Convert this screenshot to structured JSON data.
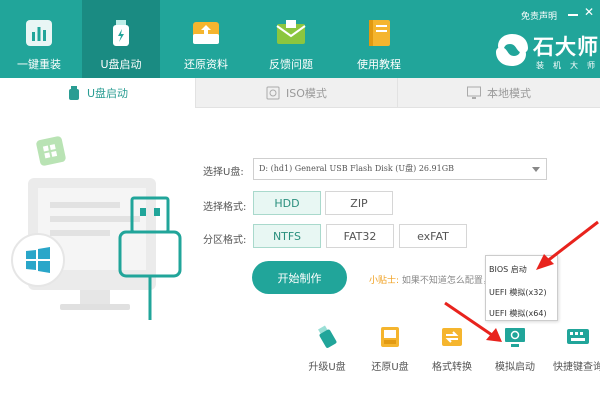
{
  "top_nav": {
    "items": [
      {
        "label": "一键重装",
        "icon": "bar-chart-icon"
      },
      {
        "label": "U盘启动",
        "icon": "usb-icon"
      },
      {
        "label": "还原资料",
        "icon": "restore-icon"
      },
      {
        "label": "反馈问题",
        "icon": "envelope-icon"
      },
      {
        "label": "使用教程",
        "icon": "book-icon"
      }
    ],
    "active_index": 1
  },
  "header": {
    "disclaimer": "免责声明",
    "minimize_glyph": "—",
    "close_glyph": "✕",
    "brand_name": "石大师",
    "brand_sub": "装机大师"
  },
  "mode_tabs": [
    {
      "label": "U盘启动",
      "icon": "usb-icon",
      "active": true
    },
    {
      "label": "ISO模式",
      "icon": "disc-icon",
      "active": false
    },
    {
      "label": "本地模式",
      "icon": "monitor-icon",
      "active": false
    }
  ],
  "form": {
    "disk_label": "选择U盘:",
    "disk_value": "D: (hd1) General USB Flash Disk  (U盘) 26.91GB",
    "format_label": "选择格式:",
    "format_options": [
      "HDD",
      "ZIP"
    ],
    "format_selected": "HDD",
    "partition_label": "分区格式:",
    "partition_options": [
      "NTFS",
      "FAT32",
      "exFAT"
    ],
    "partition_selected": "NTFS"
  },
  "start_button": "开始制作",
  "tip": {
    "key": "小贴士:",
    "value": "如果不知道怎么配置，保持默认即可"
  },
  "popup_menu": [
    "BIOS 启动",
    "UEFI 模拟(x32)",
    "UEFI 模拟(x64)"
  ],
  "tools": [
    {
      "label": "升级U盘",
      "icon": "usb-upgrade-icon"
    },
    {
      "label": "还原U盘",
      "icon": "usb-restore-icon"
    },
    {
      "label": "格式转换",
      "icon": "convert-icon"
    },
    {
      "label": "模拟启动",
      "icon": "simulate-boot-icon"
    },
    {
      "label": "快捷键查询",
      "icon": "keyboard-icon"
    }
  ],
  "colors": {
    "brand_teal": "#21a59a",
    "active_teal": "#1a8b82",
    "selected_bg": "#e8f7f3",
    "tip_orange": "#f0a020",
    "arrow_red": "#e8231d"
  }
}
